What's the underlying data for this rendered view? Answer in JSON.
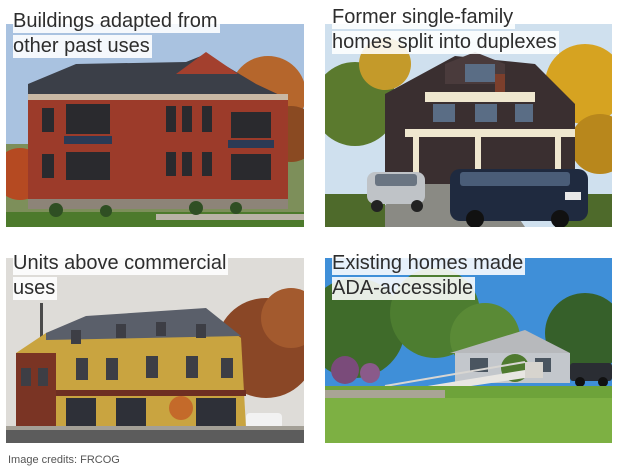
{
  "tiles": [
    {
      "caption_line1": "Buildings adapted from",
      "caption_line2": "other past uses"
    },
    {
      "caption_line1": "Former single-family",
      "caption_line2": "homes split into duplexes"
    },
    {
      "caption_line1": "Units above commercial",
      "caption_line2": "uses"
    },
    {
      "caption_line1": "Existing homes made",
      "caption_line2": "ADA-accessible"
    }
  ],
  "credits": "Image credits: FRCOG"
}
